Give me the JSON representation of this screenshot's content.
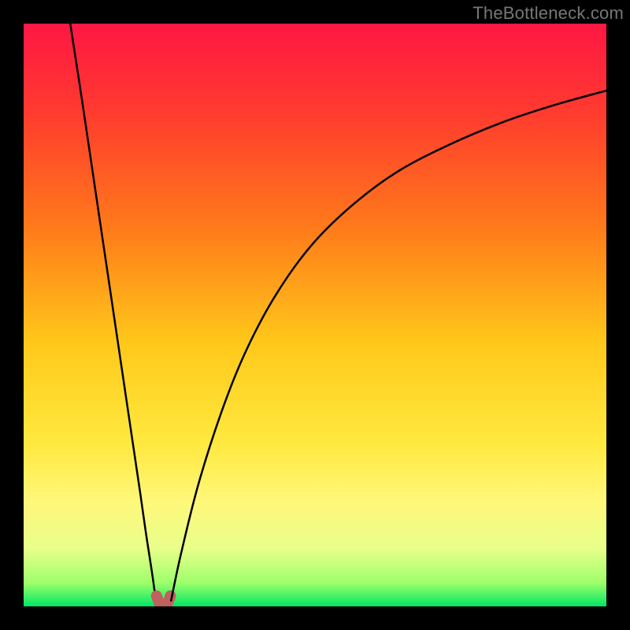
{
  "watermark": "TheBottleneck.com",
  "chart_data": {
    "type": "line",
    "title": "",
    "xlabel": "",
    "ylabel": "",
    "xlim": [
      0,
      100
    ],
    "ylim": [
      0,
      100
    ],
    "grid": false,
    "legend": false,
    "background_gradient": {
      "type": "linear-vertical",
      "stops": [
        {
          "offset": 0.0,
          "color": "#ff1744"
        },
        {
          "offset": 0.15,
          "color": "#ff3a2f"
        },
        {
          "offset": 0.35,
          "color": "#ff7a1a"
        },
        {
          "offset": 0.55,
          "color": "#ffc91a"
        },
        {
          "offset": 0.72,
          "color": "#ffe93f"
        },
        {
          "offset": 0.82,
          "color": "#fff77a"
        },
        {
          "offset": 0.9,
          "color": "#e8ff8a"
        },
        {
          "offset": 0.96,
          "color": "#9dff6a"
        },
        {
          "offset": 1.0,
          "color": "#00e763"
        }
      ]
    },
    "series": [
      {
        "name": "left-branch",
        "stroke": "#000000",
        "x": [
          8.0,
          10.0,
          12.0,
          14.0,
          16.0,
          18.0,
          20.0,
          21.0,
          22.0,
          22.7
        ],
        "y": [
          100.0,
          87.0,
          73.5,
          60.0,
          46.5,
          33.0,
          19.5,
          12.5,
          6.0,
          1.0
        ]
      },
      {
        "name": "dip-marker",
        "stroke": "#c06060",
        "marker": true,
        "x": [
          22.8,
          23.5,
          24.5,
          25.2
        ],
        "y": [
          1.8,
          0.2,
          0.2,
          1.8
        ]
      },
      {
        "name": "right-branch",
        "stroke": "#000000",
        "x": [
          25.3,
          27.0,
          30.0,
          34.0,
          38.0,
          43.0,
          49.0,
          56.0,
          64.0,
          73.0,
          82.0,
          91.0,
          100.0
        ],
        "y": [
          1.0,
          9.0,
          21.0,
          33.5,
          43.5,
          53.0,
          61.5,
          68.5,
          74.5,
          79.2,
          83.0,
          86.0,
          88.5
        ]
      }
    ]
  }
}
